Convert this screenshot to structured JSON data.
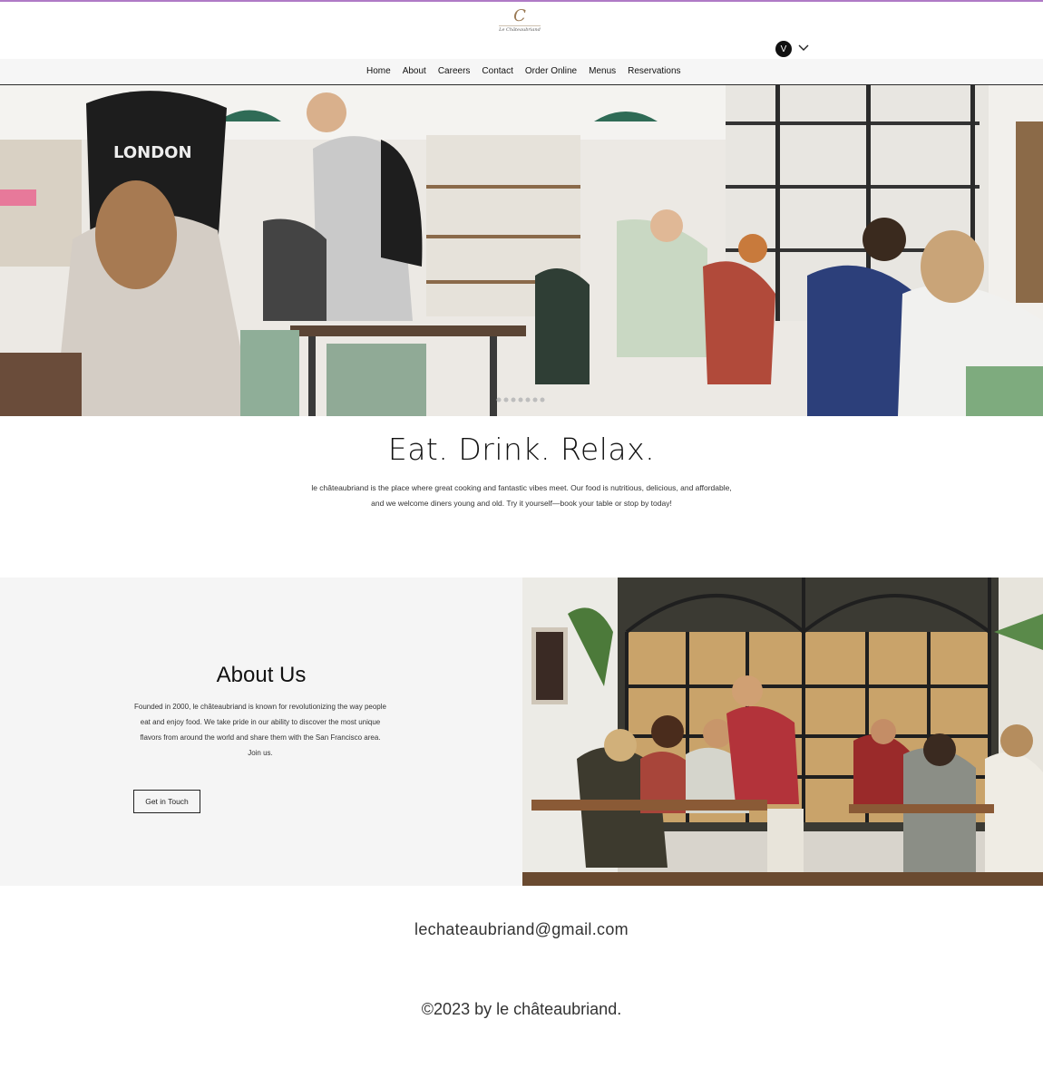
{
  "brand": {
    "logo_text": "Le Châteaubriand",
    "logo_glyph": "C"
  },
  "user": {
    "initial": "V"
  },
  "nav": {
    "items": [
      "Home",
      "About",
      "Careers",
      "Contact",
      "Order Online",
      "Menus",
      "Reservations"
    ]
  },
  "hero": {
    "title": "Eat. Drink. Relax.",
    "description": "le châteaubriand is the place where great cooking and fantastic vibes meet. Our food is nutritious, delicious, and affordable, and we welcome diners young and old. Try it yourself—book your table or stop by today!",
    "image_label": "LONDON"
  },
  "about": {
    "title": "About Us",
    "text": "Founded in 2000, le châteaubriand is known for revolutionizing the way people eat and enjoy food. We take pride in our ability to discover the most unique flavors from around the world and share them with the San Francisco area. Join us.",
    "button_label": "Get in Touch"
  },
  "footer": {
    "email": "lechateaubriand@gmail.com",
    "copyright": "©2023 by le châteaubriand."
  },
  "colors": {
    "accent_line": "#b07bc6",
    "nav_bg": "#f6f6f6",
    "about_bg": "#f5f5f5"
  }
}
